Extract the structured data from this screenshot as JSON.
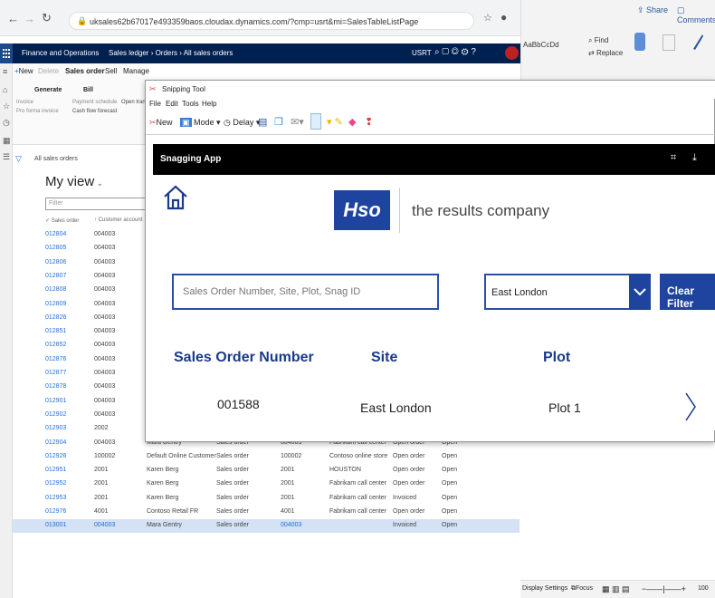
{
  "browser": {
    "url": "uksales62b67017e493359baos.cloudax.dynamics.com/?cmp=usrt&mi=SalesTableListPage"
  },
  "word": {
    "share_label": "Share",
    "comments_label": "Comments",
    "find_label": "Find",
    "replace_label": "Replace",
    "style_label": "AaBbCcDd"
  },
  "d365": {
    "app_name": "Finance and Operations",
    "breadcrumb": "Sales ledger  ›  Orders  ›  All sales orders",
    "company": "USRT",
    "actions": [
      "New",
      "Delete",
      "Sales order",
      "Sell",
      "Manage"
    ],
    "action_groups": [
      "Generate",
      "Bill"
    ],
    "action_items": [
      "Invoice",
      "Payment schedule",
      "Pro forma invoice",
      "Cash flow forecast",
      "Open trans"
    ],
    "list_title": "All sales orders",
    "view_title": "My view",
    "filter_placeholder": "Filter",
    "col_sales_order": "Sales order",
    "col_customer": "Customer account"
  },
  "list_rows": [
    {
      "order": "012804",
      "acct": "004003"
    },
    {
      "order": "012805",
      "acct": "004003"
    },
    {
      "order": "012806",
      "acct": "004003"
    },
    {
      "order": "012807",
      "acct": "004003"
    },
    {
      "order": "012808",
      "acct": "004003"
    },
    {
      "order": "012809",
      "acct": "004003"
    },
    {
      "order": "012826",
      "acct": "004003"
    },
    {
      "order": "012851",
      "acct": "004003"
    },
    {
      "order": "012852",
      "acct": "004003"
    },
    {
      "order": "012876",
      "acct": "004003"
    },
    {
      "order": "012877",
      "acct": "004003"
    },
    {
      "order": "012878",
      "acct": "004003"
    },
    {
      "order": "012901",
      "acct": "004003"
    },
    {
      "order": "012902",
      "acct": "004003",
      "name": "Mara Gentry",
      "type": "Sales order",
      "inv": "004003",
      "pool": "Fabrikam call center",
      "status": "Open order",
      "doc": "Open"
    },
    {
      "order": "012903",
      "acct": "2002",
      "name": "Mary Kay Andersen",
      "type": "Sales order",
      "inv": "2002",
      "pool": "Fabrikam call center",
      "status": "Open order",
      "doc": "Open"
    },
    {
      "order": "012904",
      "acct": "004003",
      "name": "Mara Gentry",
      "type": "Sales order",
      "inv": "004003",
      "pool": "Fabrikam call center",
      "status": "Open order",
      "doc": "Open"
    },
    {
      "order": "012926",
      "acct": "100002",
      "name": "Default Online Customer",
      "type": "Sales order",
      "inv": "100002",
      "pool": "Contoso online store",
      "status": "Open order",
      "doc": "Open"
    },
    {
      "order": "012951",
      "acct": "2001",
      "name": "Karen Berg",
      "type": "Sales order",
      "inv": "2001",
      "pool": "HOUSTON",
      "status": "Open order",
      "doc": "Open"
    },
    {
      "order": "012952",
      "acct": "2001",
      "name": "Karen Berg",
      "type": "Sales order",
      "inv": "2001",
      "pool": "Fabrikam call center",
      "status": "Open order",
      "doc": "Open"
    },
    {
      "order": "012953",
      "acct": "2001",
      "name": "Karen Berg",
      "type": "Sales order",
      "inv": "2001",
      "pool": "Fabrikam call center",
      "status": "Invoiced",
      "doc": "Open"
    },
    {
      "order": "012976",
      "acct": "4001",
      "name": "Contoso Retail FR",
      "type": "Sales order",
      "inv": "4001",
      "pool": "Fabrikam call center",
      "status": "Open order",
      "doc": "Open"
    },
    {
      "order": "013001",
      "acct": "004003",
      "name": "Mara Gentry",
      "type": "Sales order",
      "inv": "004003",
      "pool": "",
      "status": "Invoiced",
      "doc": "Open"
    }
  ],
  "snipping": {
    "title": "Snipping Tool",
    "menu": [
      "File",
      "Edit",
      "Tools",
      "Help"
    ],
    "new_label": "New",
    "mode_label": "Mode",
    "delay_label": "Delay"
  },
  "snag": {
    "app_title": "Snagging App",
    "brand_logo": "Hso",
    "tagline": "the results company",
    "search_placeholder": "Sales Order Number, Site, Plot, Snag ID",
    "filter_value": "East London",
    "clear_label": "Clear Filter",
    "headers": [
      "Sales Order Number",
      "Site",
      "Plot"
    ],
    "row": {
      "order": "001588",
      "site": "East London",
      "plot": "Plot 1"
    }
  },
  "statusbar": {
    "display_settings": "Display Settings",
    "focus": "Focus",
    "zoom": "100"
  },
  "colors": {
    "d365_nav": "#002050",
    "hso_blue": "#1f44a0",
    "link": "#1e6fd9"
  }
}
